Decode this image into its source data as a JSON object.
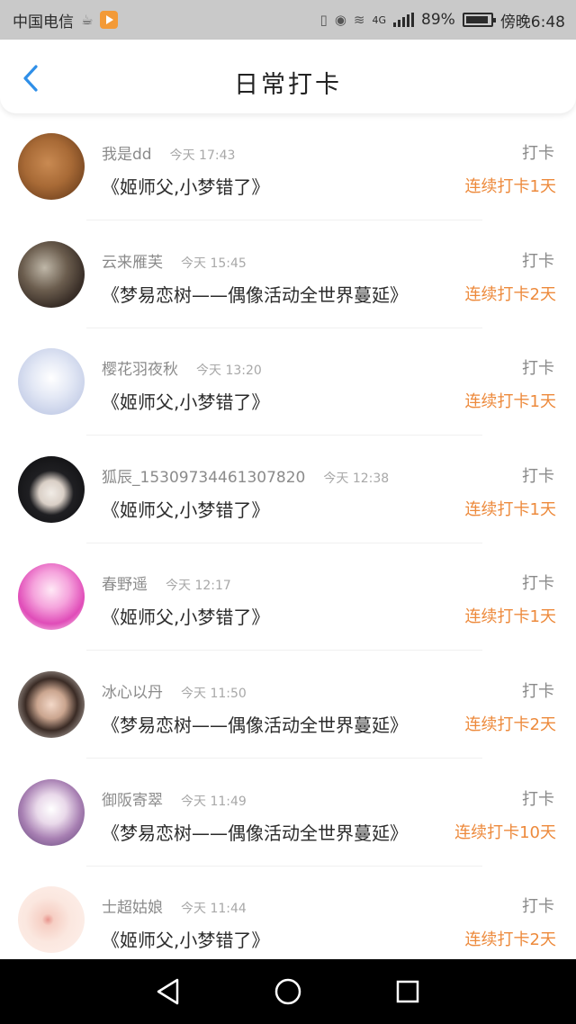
{
  "status_bar": {
    "carrier": "中国电信",
    "network": "4G",
    "battery": "89%",
    "time": "傍晚6:48"
  },
  "header": {
    "title": "日常打卡"
  },
  "list": [
    {
      "username": "我是dd",
      "time": "今天 17:43",
      "course": "《姬师父,小梦错了》",
      "type": "打卡",
      "streak": "连续打卡1天"
    },
    {
      "username": "云来雁芙",
      "time": "今天 15:45",
      "course": "《梦易恋树——偶像活动全世界蔓延》",
      "type": "打卡",
      "streak": "连续打卡2天"
    },
    {
      "username": "樱花羽夜秋",
      "time": "今天 13:20",
      "course": "《姬师父,小梦错了》",
      "type": "打卡",
      "streak": "连续打卡1天"
    },
    {
      "username": "狐辰_15309734461307820",
      "time": "今天 12:38",
      "course": "《姬师父,小梦错了》",
      "type": "打卡",
      "streak": "连续打卡1天"
    },
    {
      "username": "春野遥",
      "time": "今天 12:17",
      "course": "《姬师父,小梦错了》",
      "type": "打卡",
      "streak": "连续打卡1天"
    },
    {
      "username": "冰心以丹",
      "time": "今天 11:50",
      "course": "《梦易恋树——偶像活动全世界蔓延》",
      "type": "打卡",
      "streak": "连续打卡2天"
    },
    {
      "username": "御阪寄翠",
      "time": "今天 11:49",
      "course": "《梦易恋树——偶像活动全世界蔓延》",
      "type": "打卡",
      "streak": "连续打卡10天"
    },
    {
      "username": "士超姑娘",
      "time": "今天 11:44",
      "course": "《姬师父,小梦错了》",
      "type": "打卡",
      "streak": "连续打卡2天"
    }
  ],
  "colors": {
    "accent_back": "#2f8fe8",
    "streak": "#ed8a3c"
  },
  "icons": {
    "back": "chevron-left-icon",
    "nav": [
      "back-triangle-icon",
      "home-circle-icon",
      "recents-square-icon"
    ]
  }
}
